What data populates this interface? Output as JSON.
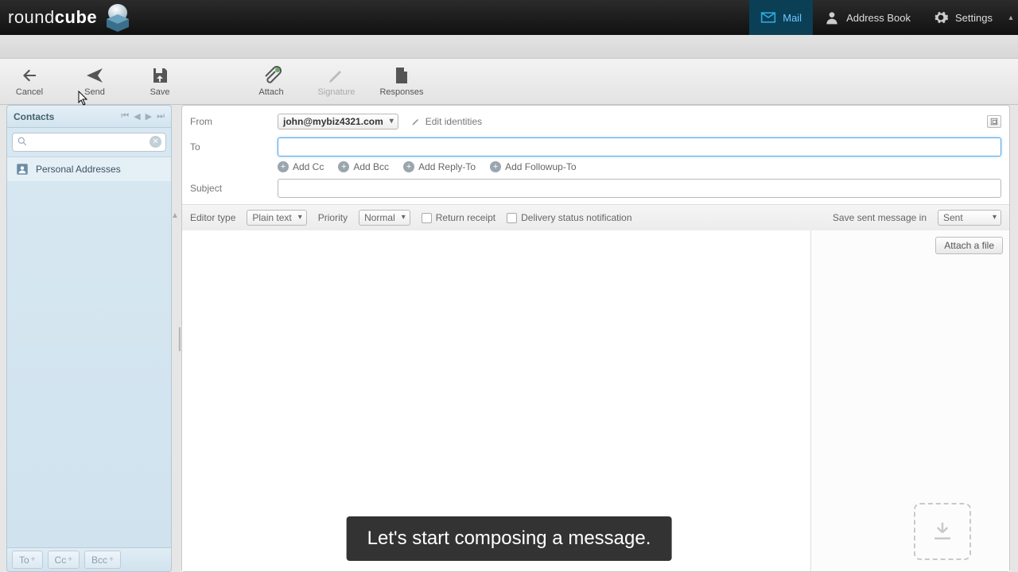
{
  "app": {
    "name_plain": "round",
    "name_bold": "cube"
  },
  "topnav": {
    "mail": "Mail",
    "address_book": "Address Book",
    "settings": "Settings"
  },
  "toolbar": {
    "cancel": "Cancel",
    "send": "Send",
    "save": "Save",
    "attach": "Attach",
    "signature": "Signature",
    "responses": "Responses"
  },
  "sidebar": {
    "title": "Contacts",
    "search_placeholder": "",
    "items": [
      {
        "label": "Personal Addresses"
      }
    ],
    "footer": {
      "to": "To",
      "cc": "Cc",
      "bcc": "Bcc"
    }
  },
  "compose": {
    "labels": {
      "from": "From",
      "to": "To",
      "subject": "Subject"
    },
    "from_value": "john@mybiz4321.com",
    "edit_identities": "Edit identities",
    "to_value": "",
    "subject_value": "",
    "add": {
      "cc": "Add Cc",
      "bcc": "Add Bcc",
      "reply": "Add Reply-To",
      "followup": "Add Followup-To"
    },
    "options": {
      "editor_type_label": "Editor type",
      "editor_type_value": "Plain text",
      "priority_label": "Priority",
      "priority_value": "Normal",
      "return_receipt": "Return receipt",
      "dsn": "Delivery status notification",
      "save_in_label": "Save sent message in",
      "save_in_value": "Sent"
    },
    "attach_button": "Attach a file"
  },
  "caption": "Let's start composing a message."
}
